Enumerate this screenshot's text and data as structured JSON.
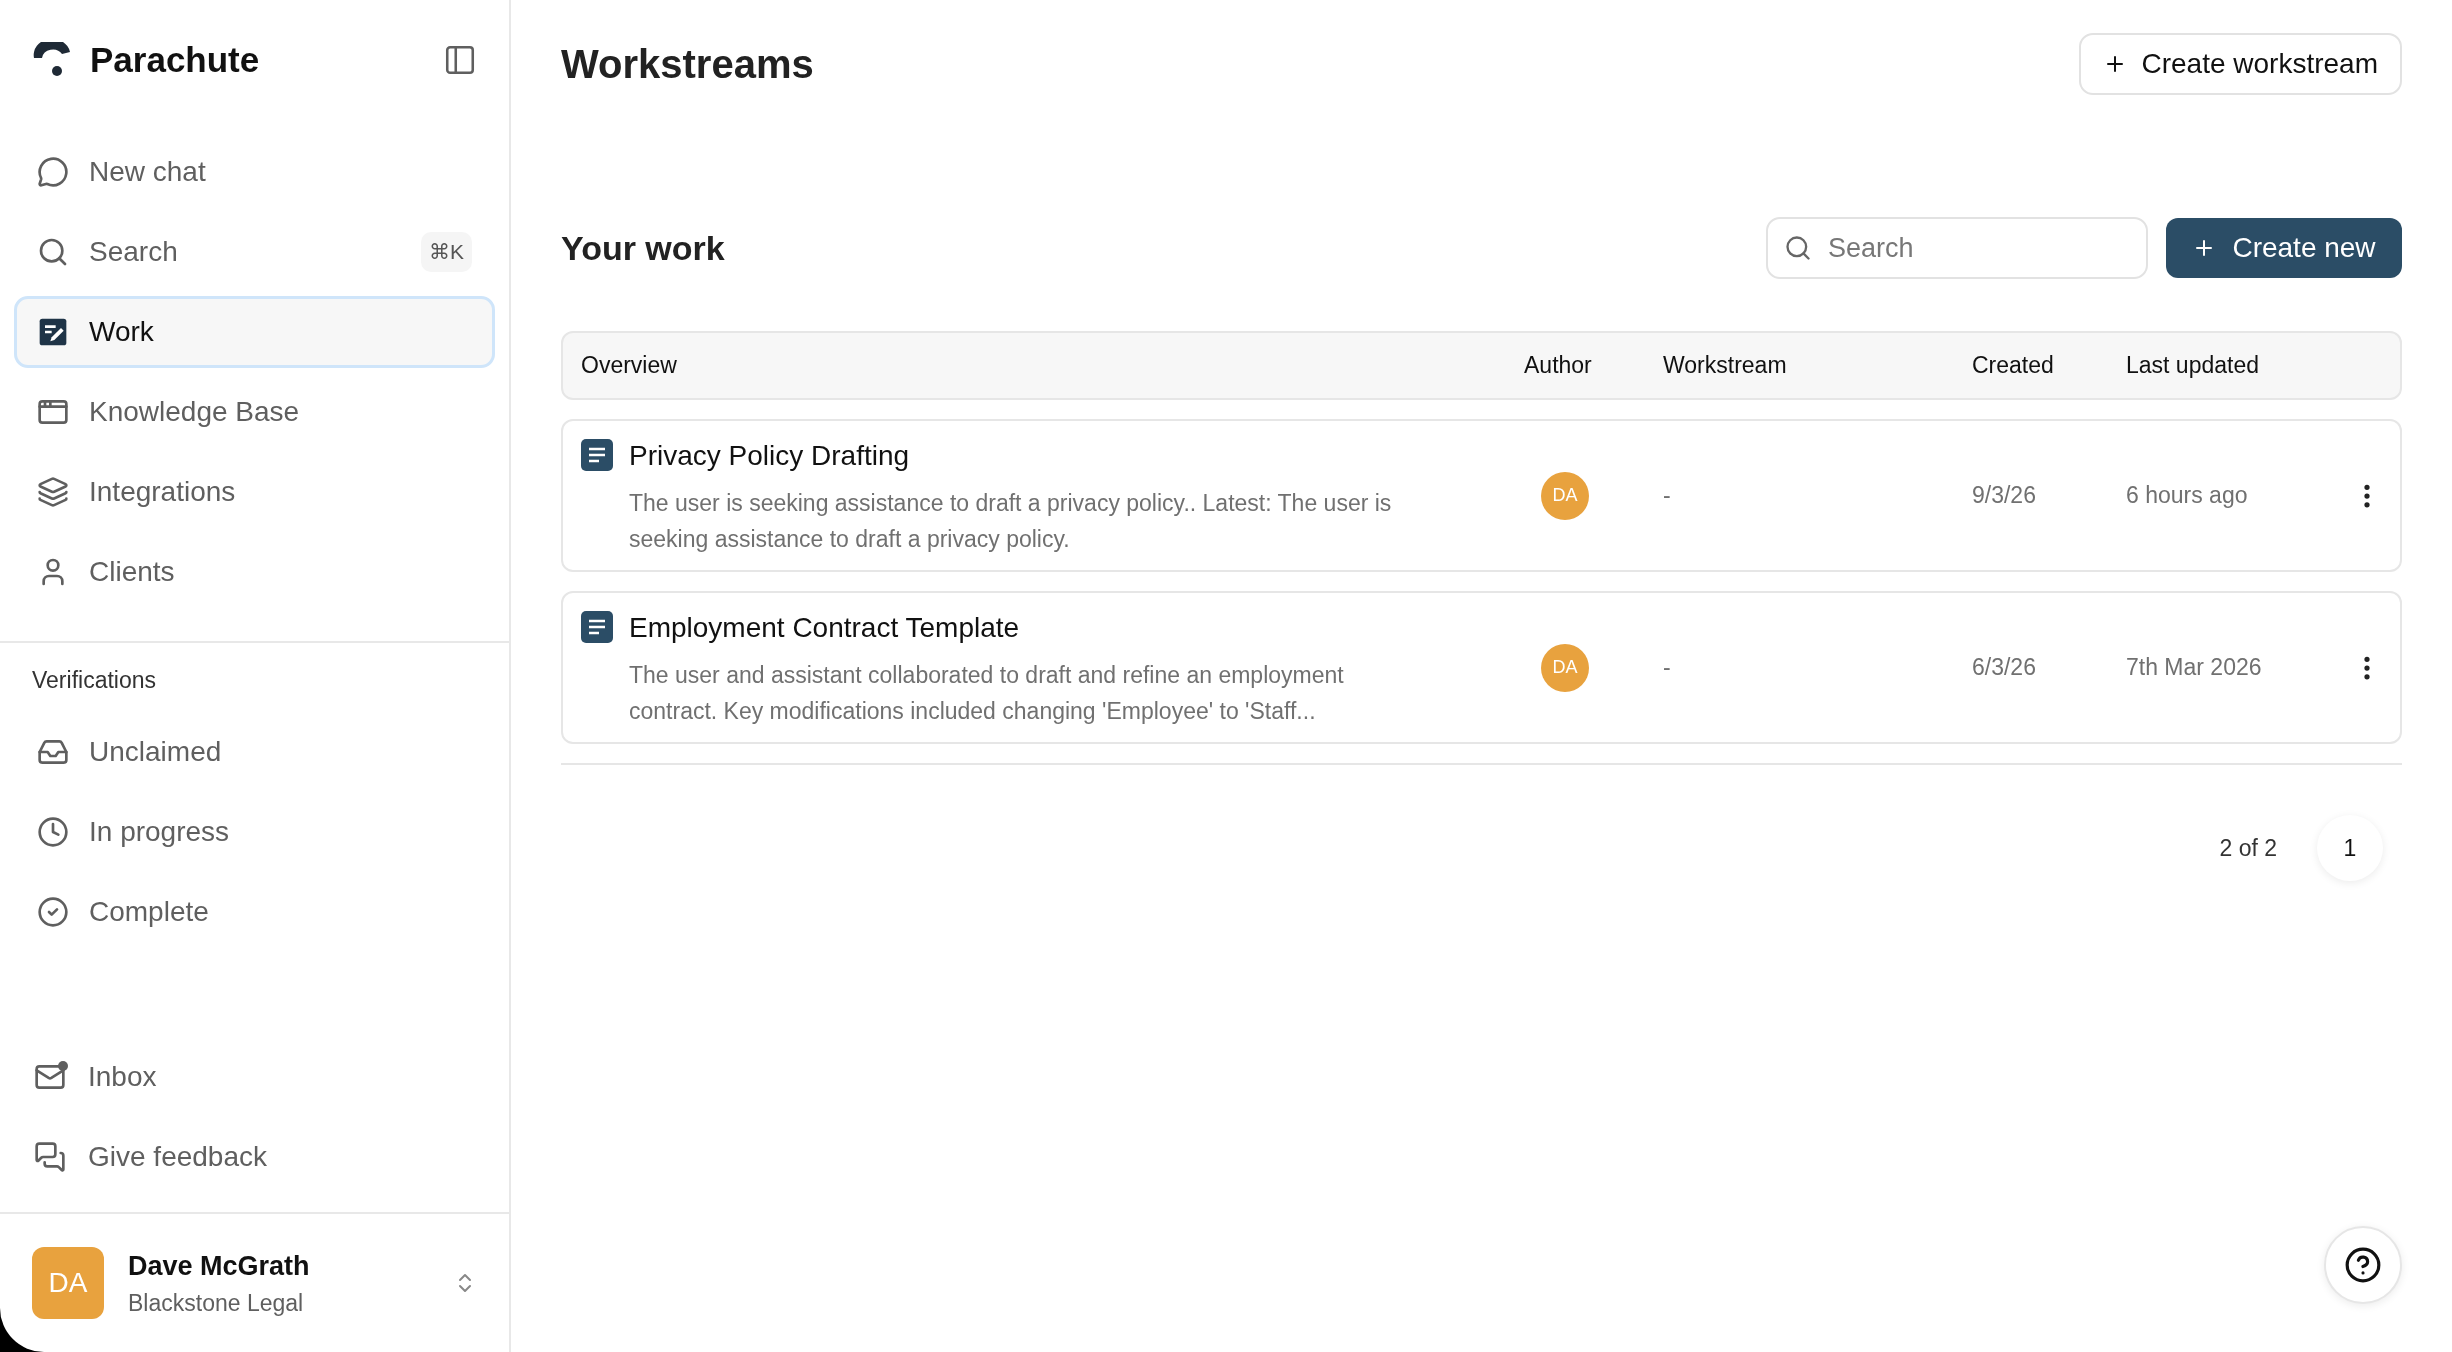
{
  "sidebar": {
    "brand": "Parachute",
    "nav": [
      {
        "label": "New chat",
        "selected": false
      },
      {
        "label": "Search",
        "selected": false,
        "shortcut": "⌘K"
      },
      {
        "label": "Work",
        "selected": true
      },
      {
        "label": "Knowledge Base",
        "selected": false
      },
      {
        "label": "Integrations",
        "selected": false
      },
      {
        "label": "Clients",
        "selected": false
      }
    ],
    "section_title": "Verifications",
    "verification_items": [
      {
        "label": "Unclaimed",
        "selected": false
      },
      {
        "label": "In progress",
        "selected": false
      },
      {
        "label": "Complete",
        "selected": false
      }
    ],
    "footer_items": [
      {
        "label": "Inbox",
        "unread": true
      },
      {
        "label": "Give feedback",
        "unread": false
      }
    ],
    "user": {
      "initials": "DA",
      "name": "Dave McGrath",
      "org": "Blackstone Legal"
    }
  },
  "header": {
    "title": "Workstreams",
    "action": "Create workstream"
  },
  "section": {
    "title": "Your work",
    "search": {
      "placeholder": "Search"
    },
    "create_button": "Create new"
  },
  "table": {
    "columns": [
      "Overview",
      "Author",
      "Workstream",
      "Created",
      "Last updated"
    ],
    "rows": [
      {
        "title": "Privacy Policy Drafting",
        "description": "The user is seeking assistance to draft a privacy policy.. Latest: The user is seeking assistance to draft a privacy policy.",
        "author": "DA",
        "workstream": "-",
        "created": "9/3/26",
        "last_updated": "6 hours ago"
      },
      {
        "title": "Employment Contract Template",
        "description": "The user and assistant collaborated to draft and refine an employment contract. Key modifications included changing 'Employee' to 'Staff...",
        "author": "DA",
        "workstream": "-",
        "created": "6/3/26",
        "last_updated": "7th Mar 2026"
      }
    ]
  },
  "pagination": {
    "summary": "2 of 2",
    "pages": [
      {
        "label": "1",
        "selected": true
      }
    ]
  }
}
